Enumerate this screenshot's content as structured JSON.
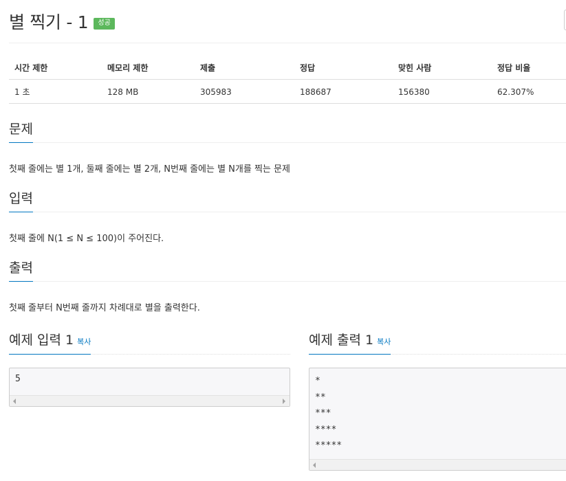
{
  "problem": {
    "title": "별 찍기 - 1",
    "status_badge": "성공"
  },
  "info_table": {
    "headers": [
      "시간 제한",
      "메모리 제한",
      "제출",
      "정답",
      "맞힌 사람",
      "정답 비율"
    ],
    "row": [
      "1 초",
      "128 MB",
      "305983",
      "188687",
      "156380",
      "62.307%"
    ]
  },
  "sections": {
    "description": {
      "heading": "문제",
      "text": "첫째 줄에는 별 1개, 둘째 줄에는 별 2개, N번째 줄에는 별 N개를 찍는 문제"
    },
    "input": {
      "heading": "입력",
      "text": "첫째 줄에 N(1 ≤ N ≤ 100)이 주어진다."
    },
    "output": {
      "heading": "출력",
      "text": "첫째 줄부터 N번째 줄까지 차례대로 별을 출력한다."
    }
  },
  "samples": {
    "input": {
      "heading": "예제 입력 1",
      "copy_label": "복사",
      "lines": [
        "5"
      ]
    },
    "output": {
      "heading": "예제 출력 1",
      "copy_label": "복사",
      "lines": [
        "*",
        "**",
        "***",
        "****",
        "*****"
      ]
    }
  }
}
